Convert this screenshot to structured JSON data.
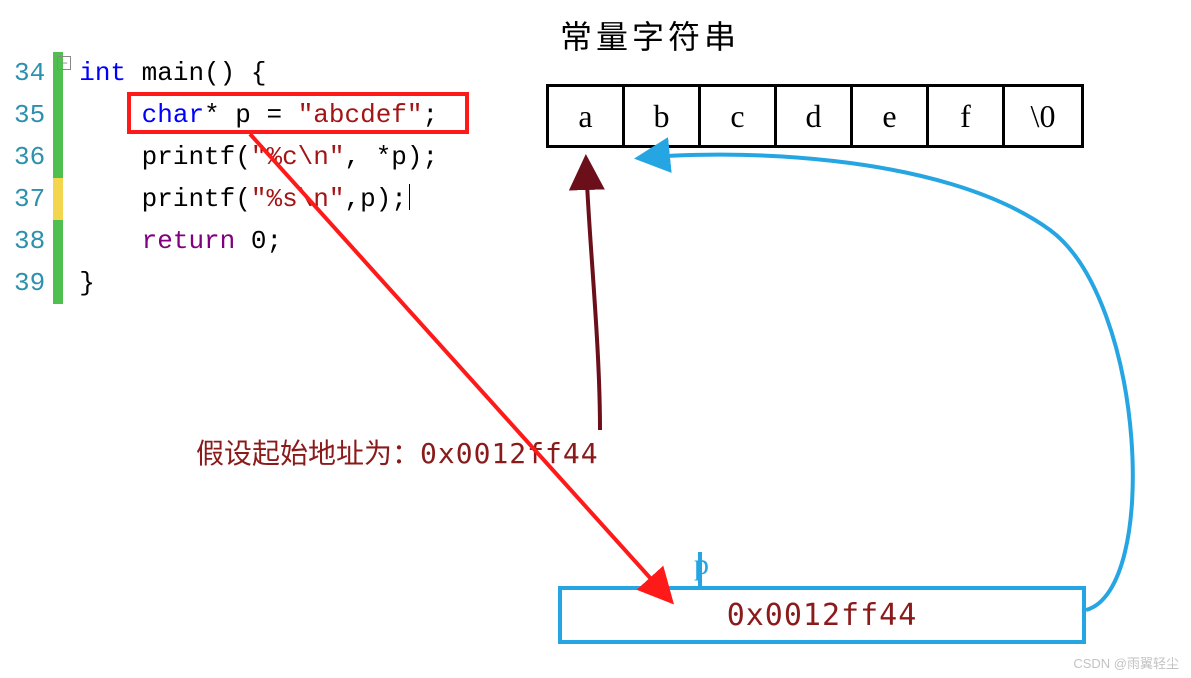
{
  "code": {
    "line_numbers": [
      "34",
      "35",
      "36",
      "37",
      "38",
      "39"
    ],
    "markers": [
      "green",
      "green",
      "green",
      "yellow",
      "green",
      "green"
    ],
    "l34": {
      "kw": "int",
      "fn": " main() {"
    },
    "l35": {
      "kw": "char",
      "star": "* p = ",
      "str": "\"abcdef\"",
      "end": ";"
    },
    "l36": {
      "fn": "printf(",
      "str": "\"%c\\n\"",
      "args": ", *p);"
    },
    "l37": {
      "fn": "printf(",
      "str": "\"%s\\n\"",
      "args": ",p);"
    },
    "l38": {
      "kw": "return",
      "rest": " 0;"
    },
    "l39": {
      "brace": "}"
    }
  },
  "diagram": {
    "title": "常量字符串",
    "cells": [
      "a",
      "b",
      "c",
      "d",
      "e",
      "f",
      "\\0"
    ],
    "addr_label_prefix": "假设起始地址为：",
    "addr_value": "0x0012ff44",
    "pointer_name": "p",
    "pointer_box_value": "0x0012ff44"
  },
  "watermark": "CSDN @雨翼轻尘",
  "colors": {
    "red": "#ff1a1a",
    "darkred": "#6b0f1a",
    "blue": "#26a5e3",
    "textred": "#8b1a1a"
  }
}
